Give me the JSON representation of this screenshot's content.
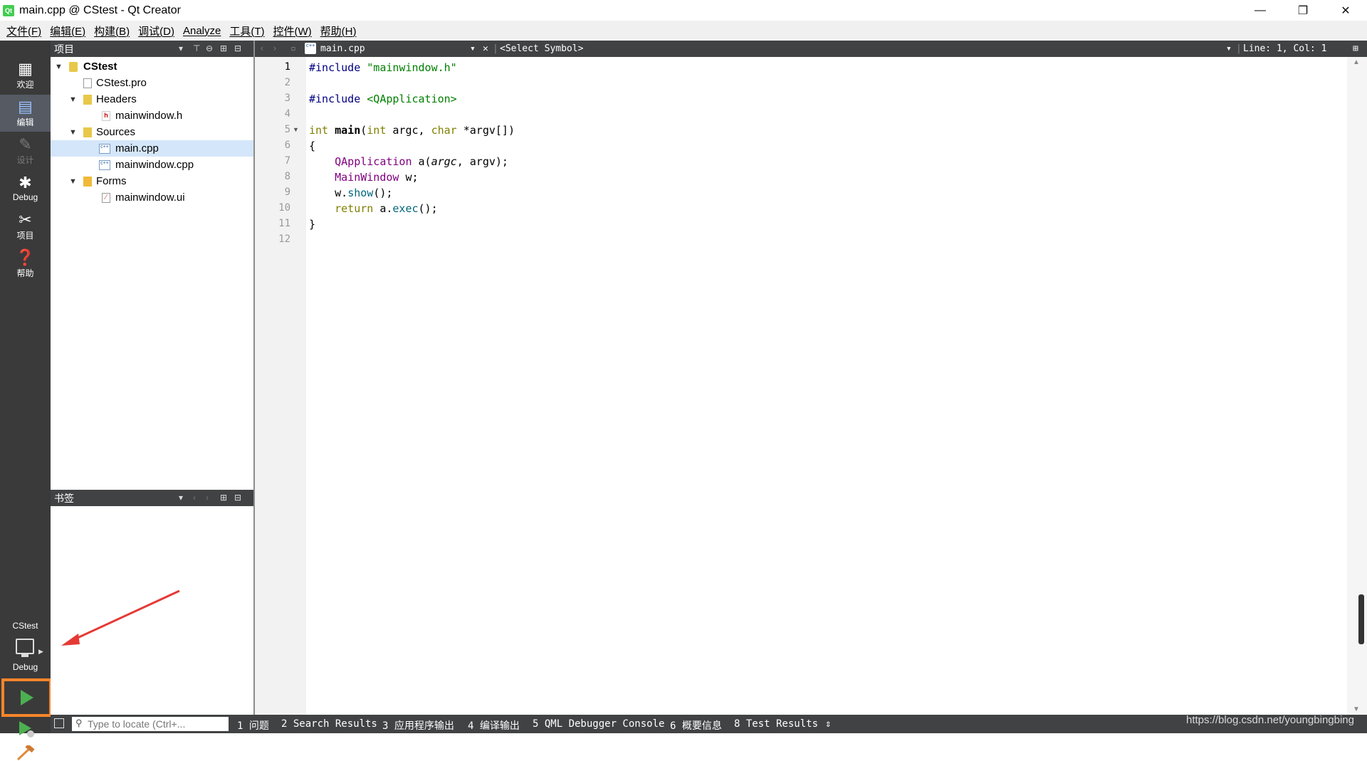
{
  "window": {
    "title": "main.cpp @ CStest - Qt Creator",
    "logo_text": "Qt",
    "minimize": "—",
    "restore": "❐",
    "close": "✕"
  },
  "menu": [
    "文件(F)",
    "编辑(E)",
    "构建(B)",
    "调试(D)",
    "Analyze",
    "工具(T)",
    "控件(W)",
    "帮助(H)"
  ],
  "modes": [
    {
      "label": "欢迎",
      "icon": "grid-icon"
    },
    {
      "label": "编辑",
      "icon": "document-icon"
    },
    {
      "label": "设计",
      "icon": "pencil-icon"
    },
    {
      "label": "Debug",
      "icon": "bug-icon"
    },
    {
      "label": "项目",
      "icon": "wrench-icon"
    },
    {
      "label": "帮助",
      "icon": "help-icon"
    }
  ],
  "kit": {
    "project": "CStest",
    "build": "Debug"
  },
  "project_panel": {
    "title": "项目",
    "tree": [
      {
        "label": "CStest",
        "level": 0,
        "expanded": true,
        "kind": "project"
      },
      {
        "label": "CStest.pro",
        "level": 1,
        "kind": "pro"
      },
      {
        "label": "Headers",
        "level": 1,
        "expanded": true,
        "kind": "folder"
      },
      {
        "label": "mainwindow.h",
        "level": 2,
        "kind": "header"
      },
      {
        "label": "Sources",
        "level": 1,
        "expanded": true,
        "kind": "folder"
      },
      {
        "label": "main.cpp",
        "level": 2,
        "kind": "cpp",
        "selected": true
      },
      {
        "label": "mainwindow.cpp",
        "level": 2,
        "kind": "cpp"
      },
      {
        "label": "Forms",
        "level": 1,
        "expanded": true,
        "kind": "folder"
      },
      {
        "label": "mainwindow.ui",
        "level": 2,
        "kind": "ui"
      }
    ]
  },
  "bookmarks_panel": {
    "title": "书签"
  },
  "editor": {
    "file": "main.cpp",
    "symbol": "<Select Symbol>",
    "position": "Line: 1, Col: 1",
    "lines": [
      "1",
      "2",
      "3",
      "4",
      "5",
      "6",
      "7",
      "8",
      "9",
      "10",
      "11",
      "12"
    ]
  },
  "locator": {
    "placeholder": "Type to locate (Ctrl+..."
  },
  "output_panes": [
    "1 问题",
    "2 Search Results",
    "3 应用程序输出",
    "4 编译输出",
    "5 QML Debugger Console",
    "6 概要信息",
    "8 Test Results"
  ],
  "watermark": "https://blog.csdn.net/youngbingbing",
  "colors": {
    "accent_highlight": "#f7852a",
    "run": "#4caf50",
    "sidebar": "#3a3a3a"
  }
}
